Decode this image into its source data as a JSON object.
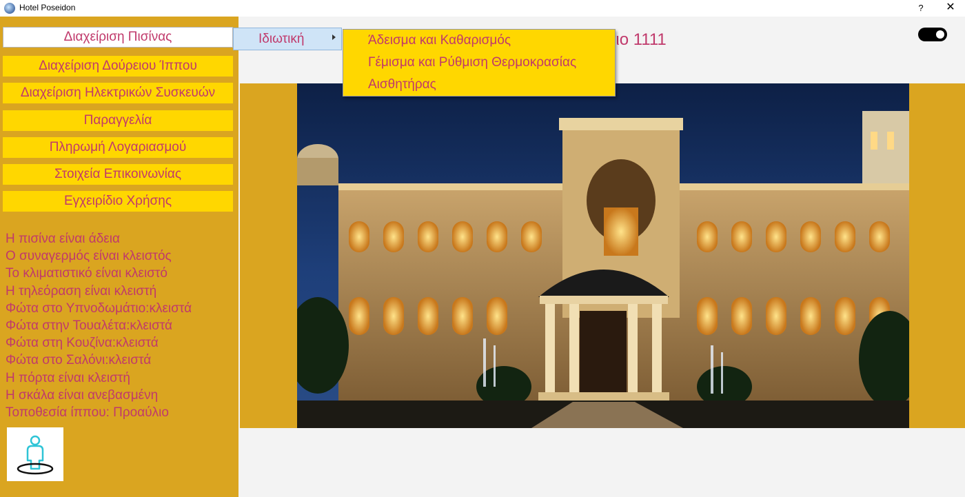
{
  "window": {
    "title": "Hotel Poseidon",
    "help_label": "?",
    "close_label": "✕"
  },
  "sidebar": {
    "menu": [
      {
        "label": "Διαχείριση Πισίνας"
      },
      {
        "label": "Διαχείριση Δούρειου Ίππου"
      },
      {
        "label": "Διαχείριση Ηλεκτρικών Συσκευών"
      },
      {
        "label": "Παραγγελία"
      },
      {
        "label": "Πληρωμή Λογαριασμού"
      },
      {
        "label": "Στοιχεία Επικοινωνίας"
      },
      {
        "label": "Εγχειρίδιο Χρήσης"
      }
    ],
    "status": [
      "Η πισίνα είναι άδεια",
      "Ο συναγερμός είναι κλειστός",
      "Το κλιματιστικό είναι κλειστό",
      "Η τηλεόραση είναι κλειστή",
      "Φώτα στο Υπνοδωμάτιο:κλειστά",
      "Φώτα στην Τουαλέτα:κλειστά",
      "Φώτα στη Κουζίνα:κλειστά",
      "Φώτα στο Σαλόνι:κλειστά",
      "Η πόρτα είναι κλειστή",
      "Η σκάλα είναι ανεβασμένη",
      "Τοποθεσία ίππου: Προαύλιο"
    ]
  },
  "main": {
    "room_title_visible": "άτιο 1111"
  },
  "submenu": {
    "label": "Ιδιωτική"
  },
  "popup": {
    "items": [
      "Άδεισμα και Καθαρισμός",
      "Γέμισμα και Ρύθμιση Θερμοκρασίας",
      "Αισθητήρας"
    ]
  },
  "colors": {
    "sidebar": "#daa520",
    "button": "#ffd700",
    "text": "#c0396b",
    "main_bg": "#f3f3f3"
  }
}
